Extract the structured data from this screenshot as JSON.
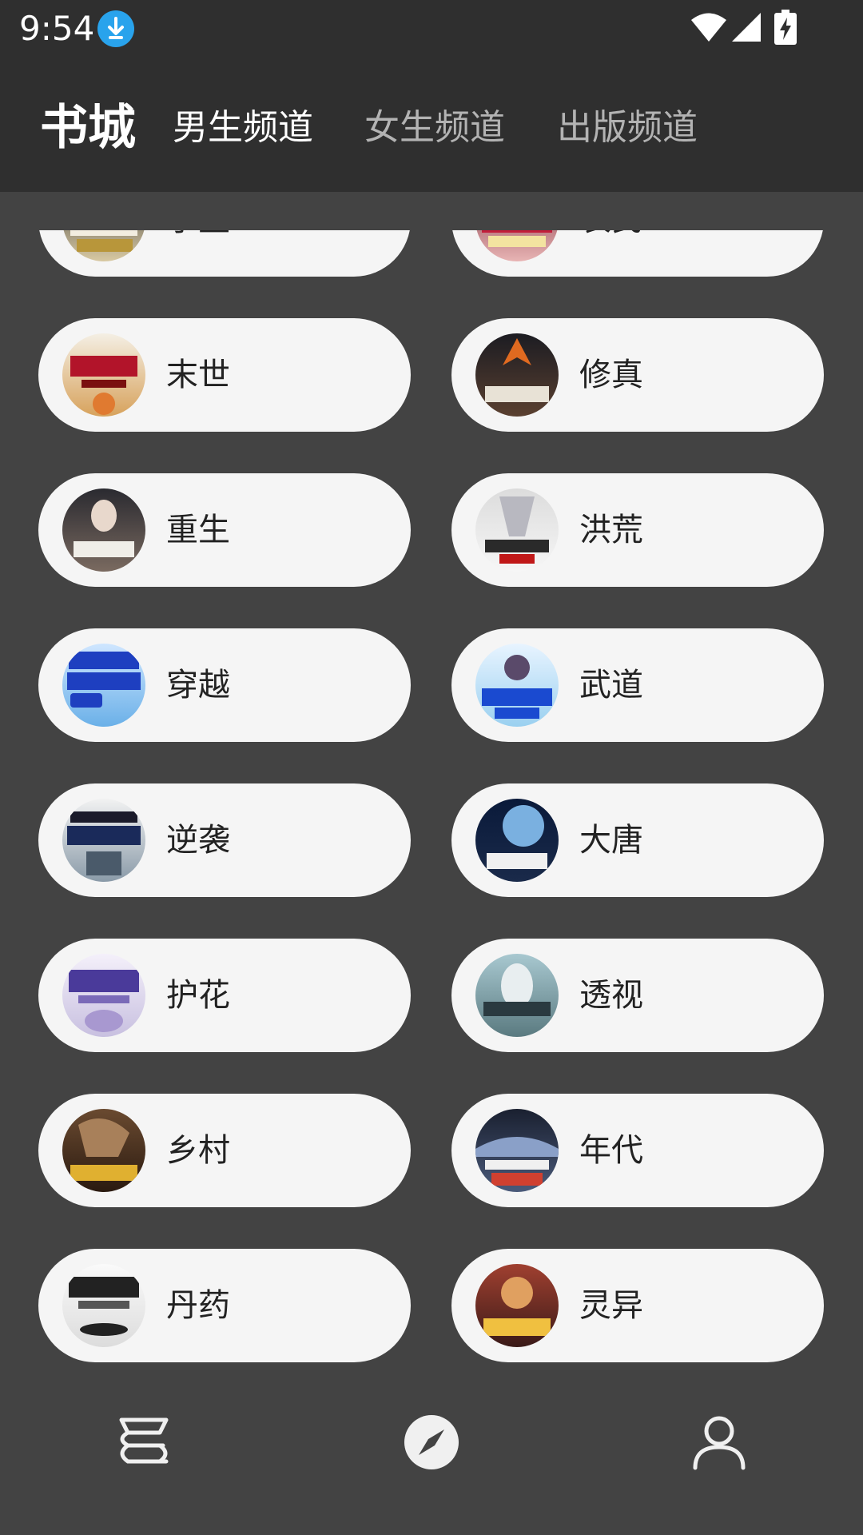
{
  "status_bar": {
    "time": "9:54",
    "icons": [
      "download-icon",
      "wifi-icon",
      "signal-icon",
      "battery-charging-icon"
    ]
  },
  "header": {
    "title": "书城",
    "tabs": [
      {
        "label": "男生频道",
        "active": true
      },
      {
        "label": "女生频道",
        "active": false
      },
      {
        "label": "出版频道",
        "active": false
      }
    ]
  },
  "categories": [
    {
      "label": "学生"
    },
    {
      "label": "农民"
    },
    {
      "label": "末世"
    },
    {
      "label": "修真"
    },
    {
      "label": "重生"
    },
    {
      "label": "洪荒"
    },
    {
      "label": "穿越"
    },
    {
      "label": "武道"
    },
    {
      "label": "逆袭"
    },
    {
      "label": "大唐"
    },
    {
      "label": "护花"
    },
    {
      "label": "透视"
    },
    {
      "label": "乡村"
    },
    {
      "label": "年代"
    },
    {
      "label": "丹药"
    },
    {
      "label": "灵异"
    }
  ],
  "bottom_nav": [
    {
      "icon": "bookshelf-icon",
      "active": false
    },
    {
      "icon": "compass-icon",
      "active": true
    },
    {
      "icon": "profile-icon",
      "active": false
    }
  ],
  "colors": {
    "background": "#434343",
    "bar": "#2f2f2f",
    "pill": "#f5f5f5",
    "active_tab": "#ffffff",
    "inactive_tab": "#b3b3b3"
  }
}
